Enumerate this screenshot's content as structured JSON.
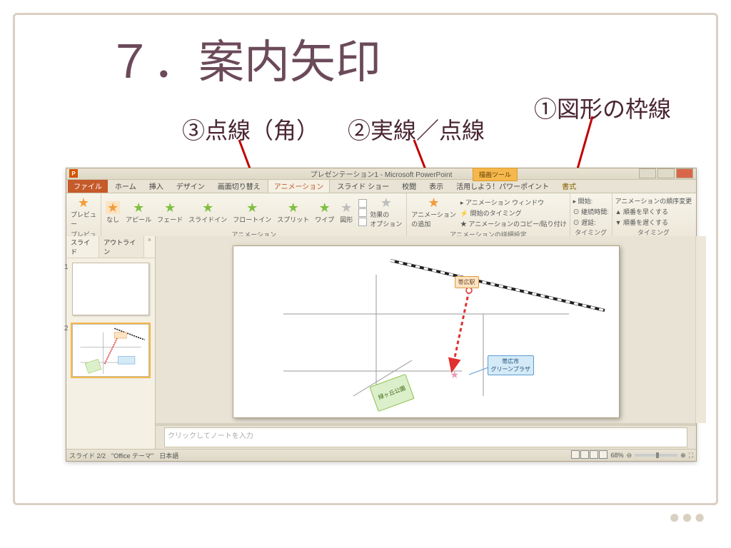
{
  "title": "７．案内矢印",
  "callouts": {
    "c1": "①図形の枠線",
    "c2": "②実線／点線",
    "c3": "③点線（角）"
  },
  "ppt": {
    "brand": "P",
    "titlebar": "プレゼンテーション1 - Microsoft PowerPoint",
    "tool_context": "描画ツール",
    "tabs": {
      "file": "ファイル",
      "home": "ホーム",
      "insert": "挿入",
      "design": "デザイン",
      "transitions": "画面切り替え",
      "animations": "アニメーション",
      "slideshow": "スライド ショー",
      "review": "校閲",
      "view": "表示",
      "addin": "活用しよう！パワーポイント",
      "format": "書式"
    },
    "ribbon": {
      "preview": "プレビュー",
      "none": "なし",
      "appear": "アピール",
      "fade": "フェード",
      "slidein": "スライドイン",
      "floatin": "フロートイン",
      "split": "スプリット",
      "wipe": "ワイプ",
      "shape": "図形",
      "effect_options": "効果の\nオプション",
      "add_anim": "アニメーション\nの追加",
      "anim_pane": "アニメーション ウィンドウ",
      "trigger": "開始のタイミング",
      "copy_anim": "アニメーションのコピー/貼り付け",
      "start": "開始:",
      "duration": "継続時間:",
      "delay": "遅延:",
      "reorder": "アニメーションの順序変更",
      "earlier": "順番を早くする",
      "later": "順番を遅くする",
      "group_anim": "アニメーション",
      "group_detail": "アニメーションの詳細設定",
      "group_timing": "タイミング"
    },
    "side": {
      "tab_slides": "スライド",
      "tab_outline": "アウトライン",
      "close": "×"
    },
    "map": {
      "station": "帯広駅",
      "plaza": "帯広市\nグリーンプラザ",
      "park": "緑ヶ丘公園"
    },
    "notes_placeholder": "クリックしてノートを入力",
    "status": {
      "slide": "スライド 2/2",
      "theme": "\"Office テーマ\"",
      "lang": "日本語",
      "zoom": "68%"
    }
  },
  "decoration": "●●●"
}
